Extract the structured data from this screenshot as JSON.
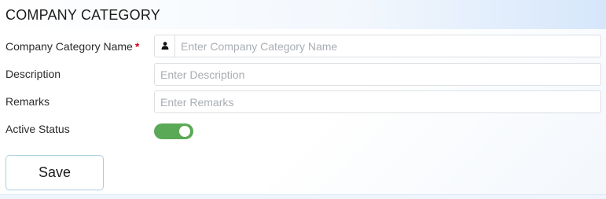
{
  "header": {
    "title": "COMPANY CATEGORY"
  },
  "form": {
    "name": {
      "label": "Company Category Name",
      "required_marker": "*",
      "placeholder": "Enter Company Category Name",
      "icon": "user-icon",
      "value": ""
    },
    "description": {
      "label": "Description",
      "placeholder": "Enter Description",
      "value": ""
    },
    "remarks": {
      "label": "Remarks",
      "placeholder": "Enter Remarks",
      "value": ""
    },
    "active_status": {
      "label": "Active Status",
      "on": true,
      "color": "#5aa956"
    }
  },
  "actions": {
    "save_label": "Save"
  },
  "colors": {
    "required": "#d0021b",
    "header_gradient_end": "#d6e6fb",
    "button_border": "#a9cfe1"
  }
}
